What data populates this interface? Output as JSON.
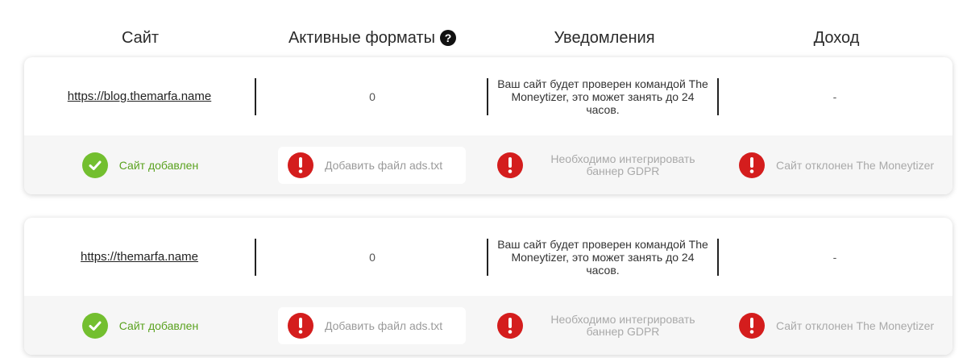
{
  "header": {
    "col_site": "Сайт",
    "col_formats": "Активные форматы",
    "col_notifications": "Уведомления",
    "col_income": "Доход"
  },
  "sites": [
    {
      "url": "https://blog.themarfa.name",
      "active_formats": "0",
      "notice": "Ваш сайт будет проверен командой The Moneytizer, это может занять до 24 часов.",
      "income": "-",
      "status_added": "Сайт добавлен",
      "status_ads": "Добавить файл ads.txt",
      "status_gdpr": "Необходимо интегрировать баннер GDPR",
      "status_rejected": "Сайт отклонен The Moneytizer"
    },
    {
      "url": "https://themarfa.name",
      "active_formats": "0",
      "notice": "Ваш сайт будет проверен командой The Moneytizer, это может занять до 24 часов.",
      "income": "-",
      "status_added": "Сайт добавлен",
      "status_ads": "Добавить файл ads.txt",
      "status_gdpr": "Необходимо интегрировать баннер GDPR",
      "status_rejected": "Сайт отклонен The Moneytizer"
    }
  ],
  "colors": {
    "success": "#73bf2f",
    "success_text": "#5aa21f",
    "alert": "#d41d1d",
    "muted_text": "#a9a9a9"
  },
  "icons": {
    "help": "question-circle-icon",
    "ok": "check-circle-icon",
    "alert": "exclamation-circle-icon"
  }
}
